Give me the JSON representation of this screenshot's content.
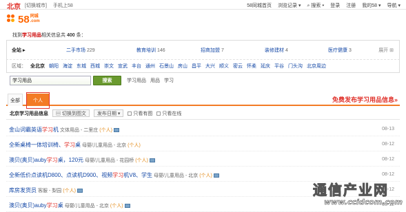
{
  "topbar": {
    "city": "北京",
    "switch_city": "[切换城市]",
    "mobile": "手机上58",
    "links": [
      "58同城首页",
      "浏览记录 ▾",
      "⌕ 搜索 ▾",
      "登录",
      "注册",
      "我的58 ▾",
      "导航 ▾"
    ]
  },
  "logo": {
    "num": "58",
    "brand": "同城",
    "domain": ".com"
  },
  "summary": {
    "prefix": "找到",
    "keyword": "学习用品",
    "middle": "相关信息共",
    "count": "400",
    "suffix": "条："
  },
  "categories": {
    "all_label": "全站 ▸",
    "items": [
      {
        "name": "二手市场",
        "count": "229"
      },
      {
        "name": "教育培训",
        "count": "146"
      },
      {
        "name": "招商加盟",
        "count": "7"
      },
      {
        "name": "装修建材",
        "count": "4"
      },
      {
        "name": "医疗健康",
        "count": "3"
      }
    ],
    "more": "展开 ⊞"
  },
  "areas": {
    "label": "区域：",
    "current": "全北京",
    "items": [
      "朝阳",
      "海淀",
      "东城",
      "西城",
      "崇文",
      "宣武",
      "丰台",
      "通州",
      "石景山",
      "房山",
      "昌平",
      "大兴",
      "顺义",
      "密云",
      "怀柔",
      "延庆",
      "平谷",
      "门头沟",
      "北京周边"
    ]
  },
  "search": {
    "value": "学习用品",
    "button": "搜索",
    "hints": [
      "学习用品",
      "用品",
      "学习"
    ]
  },
  "tabs": {
    "all": "全部",
    "person": "个人",
    "free_post": "免费发布学习用品信息»"
  },
  "toolbar": {
    "title": "北京学习用品信息",
    "view_switch": "▤ 切换到图文",
    "sort": "发布日期 ▾",
    "only_image": "只看有图",
    "only_online": "只看在线"
  },
  "listings": [
    {
      "pre": "金山词霸英语",
      "hl": "学习",
      "post": "机",
      "cat": "文体用品 - 二里庄",
      "per": "(个人)",
      "img": true,
      "date": "08-13"
    },
    {
      "pre": "全新桌椅一体培训椅、",
      "hl": "学习",
      "post": "桌",
      "cat": "母婴/儿童用品 - 北京",
      "per": "(个人)",
      "img": false,
      "date": "08-12"
    },
    {
      "pre": "澳贝(奥贝)auby",
      "hl": "学习",
      "post": "桌，120元",
      "cat": "母婴/儿童用品 - 花园桥",
      "per": "(个人)",
      "img": true,
      "date": "08-12"
    },
    {
      "pre": "全新低价点读机D800、点读机D900、视频",
      "hl": "学习",
      "post": "机V8、学生",
      "cat": "母婴/儿童用品 - 北京",
      "per": "(个人)",
      "img": true,
      "date": "08-12"
    },
    {
      "pre": "库房发货员",
      "hl": "",
      "post": "",
      "cat": "客服 - 梨园",
      "per": "(个人)",
      "img": true,
      "date": "08-12"
    },
    {
      "pre": "澳贝(奥贝)auby",
      "hl": "学习",
      "post": "桌",
      "cat": "母婴/儿童用品 - 北京",
      "per": "(个人)",
      "img": true,
      "date": "08-12"
    }
  ],
  "watermark": {
    "cn": "通信产业网",
    "url": "www.ccidcom.com"
  },
  "colors": {
    "brand": "#f37b25",
    "link": "#1448a6",
    "highlight": "#e0322b",
    "search_button": "#6a9a2e"
  }
}
